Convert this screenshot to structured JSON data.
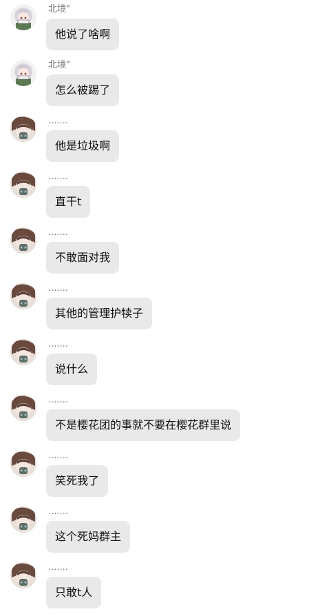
{
  "messages": [
    {
      "sender": "北境\"",
      "avatar": "anime-girl-avatar-icon",
      "text": "他说了啥啊"
    },
    {
      "sender": "北境\"",
      "avatar": "anime-girl-avatar-icon",
      "text": "怎么被踢了"
    },
    {
      "sender": ".......",
      "avatar": "masked-character-avatar-icon",
      "text": "他是垃圾啊"
    },
    {
      "sender": ".......",
      "avatar": "masked-character-avatar-icon",
      "text": "直干t"
    },
    {
      "sender": ".......",
      "avatar": "masked-character-avatar-icon",
      "text": "不敢面对我"
    },
    {
      "sender": ".......",
      "avatar": "masked-character-avatar-icon",
      "text": "其他的管理护犊子"
    },
    {
      "sender": ".......",
      "avatar": "masked-character-avatar-icon",
      "text": "说什么"
    },
    {
      "sender": ".......",
      "avatar": "masked-character-avatar-icon",
      "text": "不是樱花团的事就不要在樱花群里说"
    },
    {
      "sender": ".......",
      "avatar": "masked-character-avatar-icon",
      "text": "笑死我了"
    },
    {
      "sender": ".......",
      "avatar": "masked-character-avatar-icon",
      "text": "这个死妈群主"
    },
    {
      "sender": ".......",
      "avatar": "masked-character-avatar-icon",
      "text": "只敢t人"
    }
  ],
  "colors": {
    "background": "#ffffff",
    "bubble": "#e9e9e9",
    "name": "#7a7a7a",
    "text": "#111111"
  }
}
